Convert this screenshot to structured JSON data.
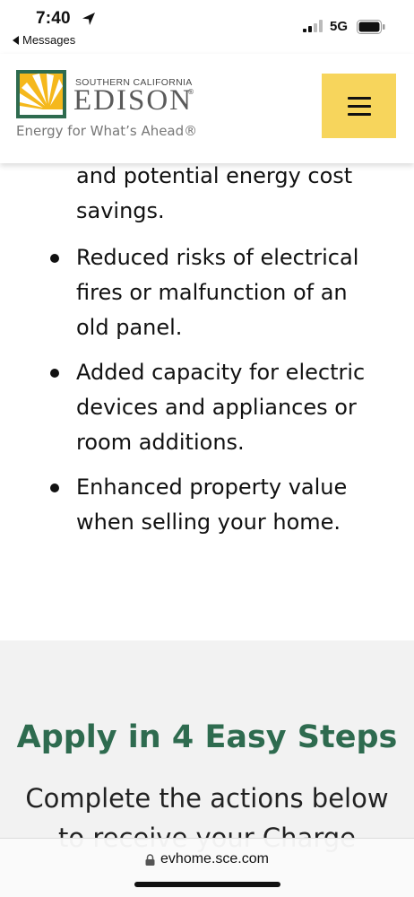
{
  "status_bar": {
    "time": "7:40",
    "back_label": "Messages",
    "network": "5G"
  },
  "header": {
    "logo_small": "SOUTHERN CALIFORNIA",
    "logo_big": "EDISON",
    "logo_reg": "®",
    "tagline": "Energy for What’s Ahead®",
    "colors": {
      "brand_yellow": "#f7d55c",
      "logo_green": "#2e6b4f",
      "logo_gray": "#5a5a5a"
    }
  },
  "content": {
    "partial_lines": [
      "and potential energy cost",
      "savings."
    ],
    "benefits": [
      {
        "lines": [
          "Reduced risks of electrical",
          "fires or malfunction of an",
          "old panel."
        ]
      },
      {
        "lines": [
          "Added capacity for electric",
          "devices and appliances or",
          "room additions."
        ]
      },
      {
        "lines": [
          "Enhanced property value",
          "when selling your home."
        ]
      }
    ]
  },
  "steps": {
    "title": "Apply in 4 Easy Steps",
    "desc_lines": [
      "Complete the actions below",
      "to receive your Charge"
    ],
    "title_color": "#2e6b4f"
  },
  "browser": {
    "url": "evhome.sce.com"
  }
}
